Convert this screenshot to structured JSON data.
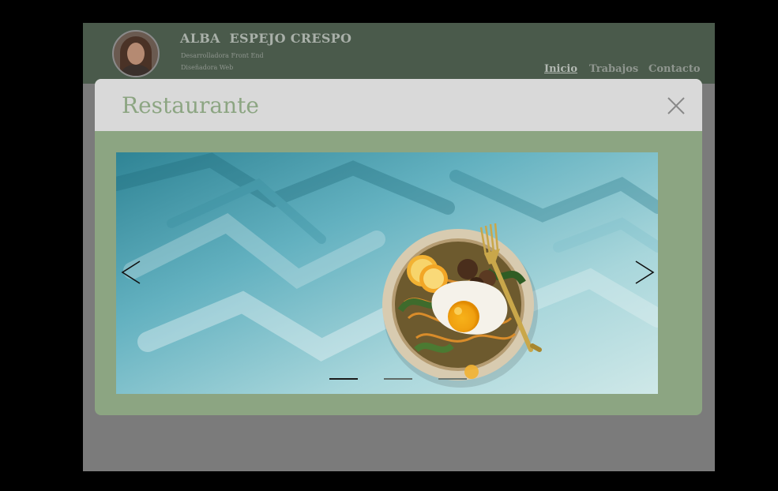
{
  "header": {
    "name": "ALBA  ESPEJO CRESPO",
    "subtitle_1": "Desarrolladora Front End",
    "subtitle_2": "Diseñadora Web",
    "nav": [
      {
        "label": "Inicio",
        "active": true
      },
      {
        "label": "Trabajos",
        "active": false
      },
      {
        "label": "Contacto",
        "active": false
      }
    ]
  },
  "modal": {
    "title": "Restaurante",
    "close_icon": "close-icon",
    "carousel": {
      "prev_icon": "chevron-left-icon",
      "next_icon": "chevron-right-icon",
      "current_slide": 1,
      "total_slides": 3
    }
  },
  "colors": {
    "header_bg": "#4a5a4b",
    "modal_bg": "#8ca582",
    "modal_header_bg": "#d9d9d9",
    "overlay": "#7b7b7b"
  }
}
